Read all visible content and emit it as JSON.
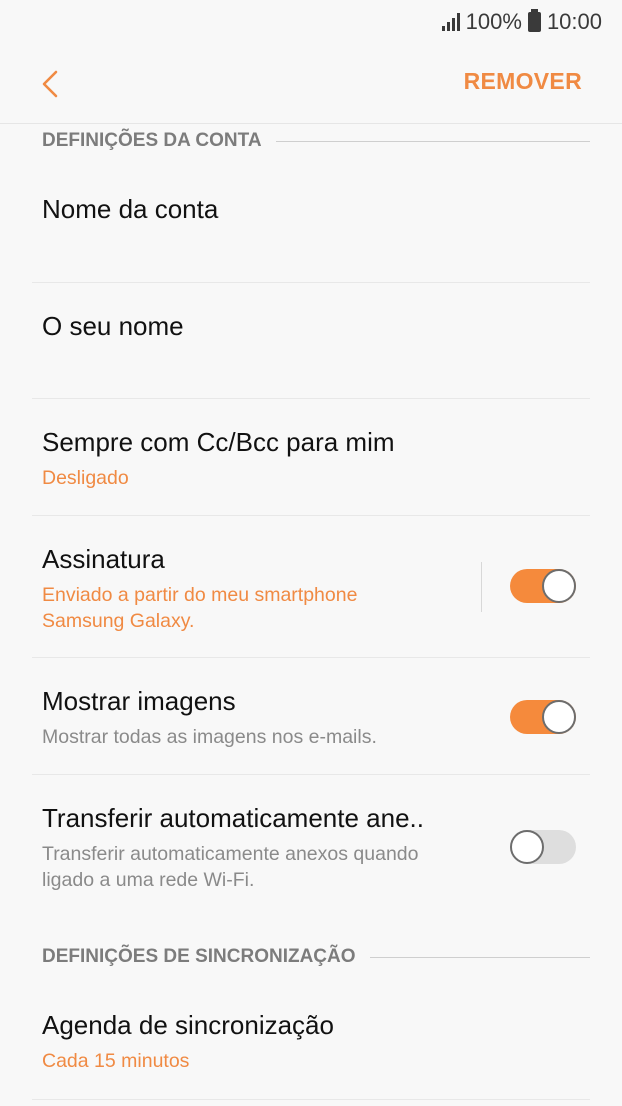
{
  "status_bar": {
    "battery": "100%",
    "time": "10:00"
  },
  "app_bar": {
    "remove_label": "REMOVER"
  },
  "sections": {
    "account": {
      "header": "DEFINIÇÕES DA CONTA"
    },
    "sync": {
      "header": "DEFINIÇÕES DE SINCRONIZAÇÃO"
    }
  },
  "items": {
    "account_name": {
      "title": "Nome da conta"
    },
    "your_name": {
      "title": "O seu nome"
    },
    "cc_bcc": {
      "title": "Sempre com Cc/Bcc para mim",
      "value": "Desligado"
    },
    "signature": {
      "title": "Assinatura",
      "value_line1": "Enviado a partir do meu smartphone",
      "value_line2": "Samsung Galaxy.",
      "toggle_on": true
    },
    "show_images": {
      "title": "Mostrar imagens",
      "desc": "Mostrar todas as imagens nos e-mails.",
      "toggle_on": true
    },
    "auto_download": {
      "title": "Transferir automaticamente ane..",
      "desc_line1": "Transferir automaticamente anexos quando",
      "desc_line2": "ligado a uma rede Wi-Fi.",
      "toggle_on": false
    },
    "sync_schedule": {
      "title": "Agenda de sincronização",
      "value": "Cada 15 minutos"
    }
  },
  "colors": {
    "accent": "#f08a43",
    "toggle_on": "#f58a3c",
    "toggle_off": "#dedede"
  }
}
